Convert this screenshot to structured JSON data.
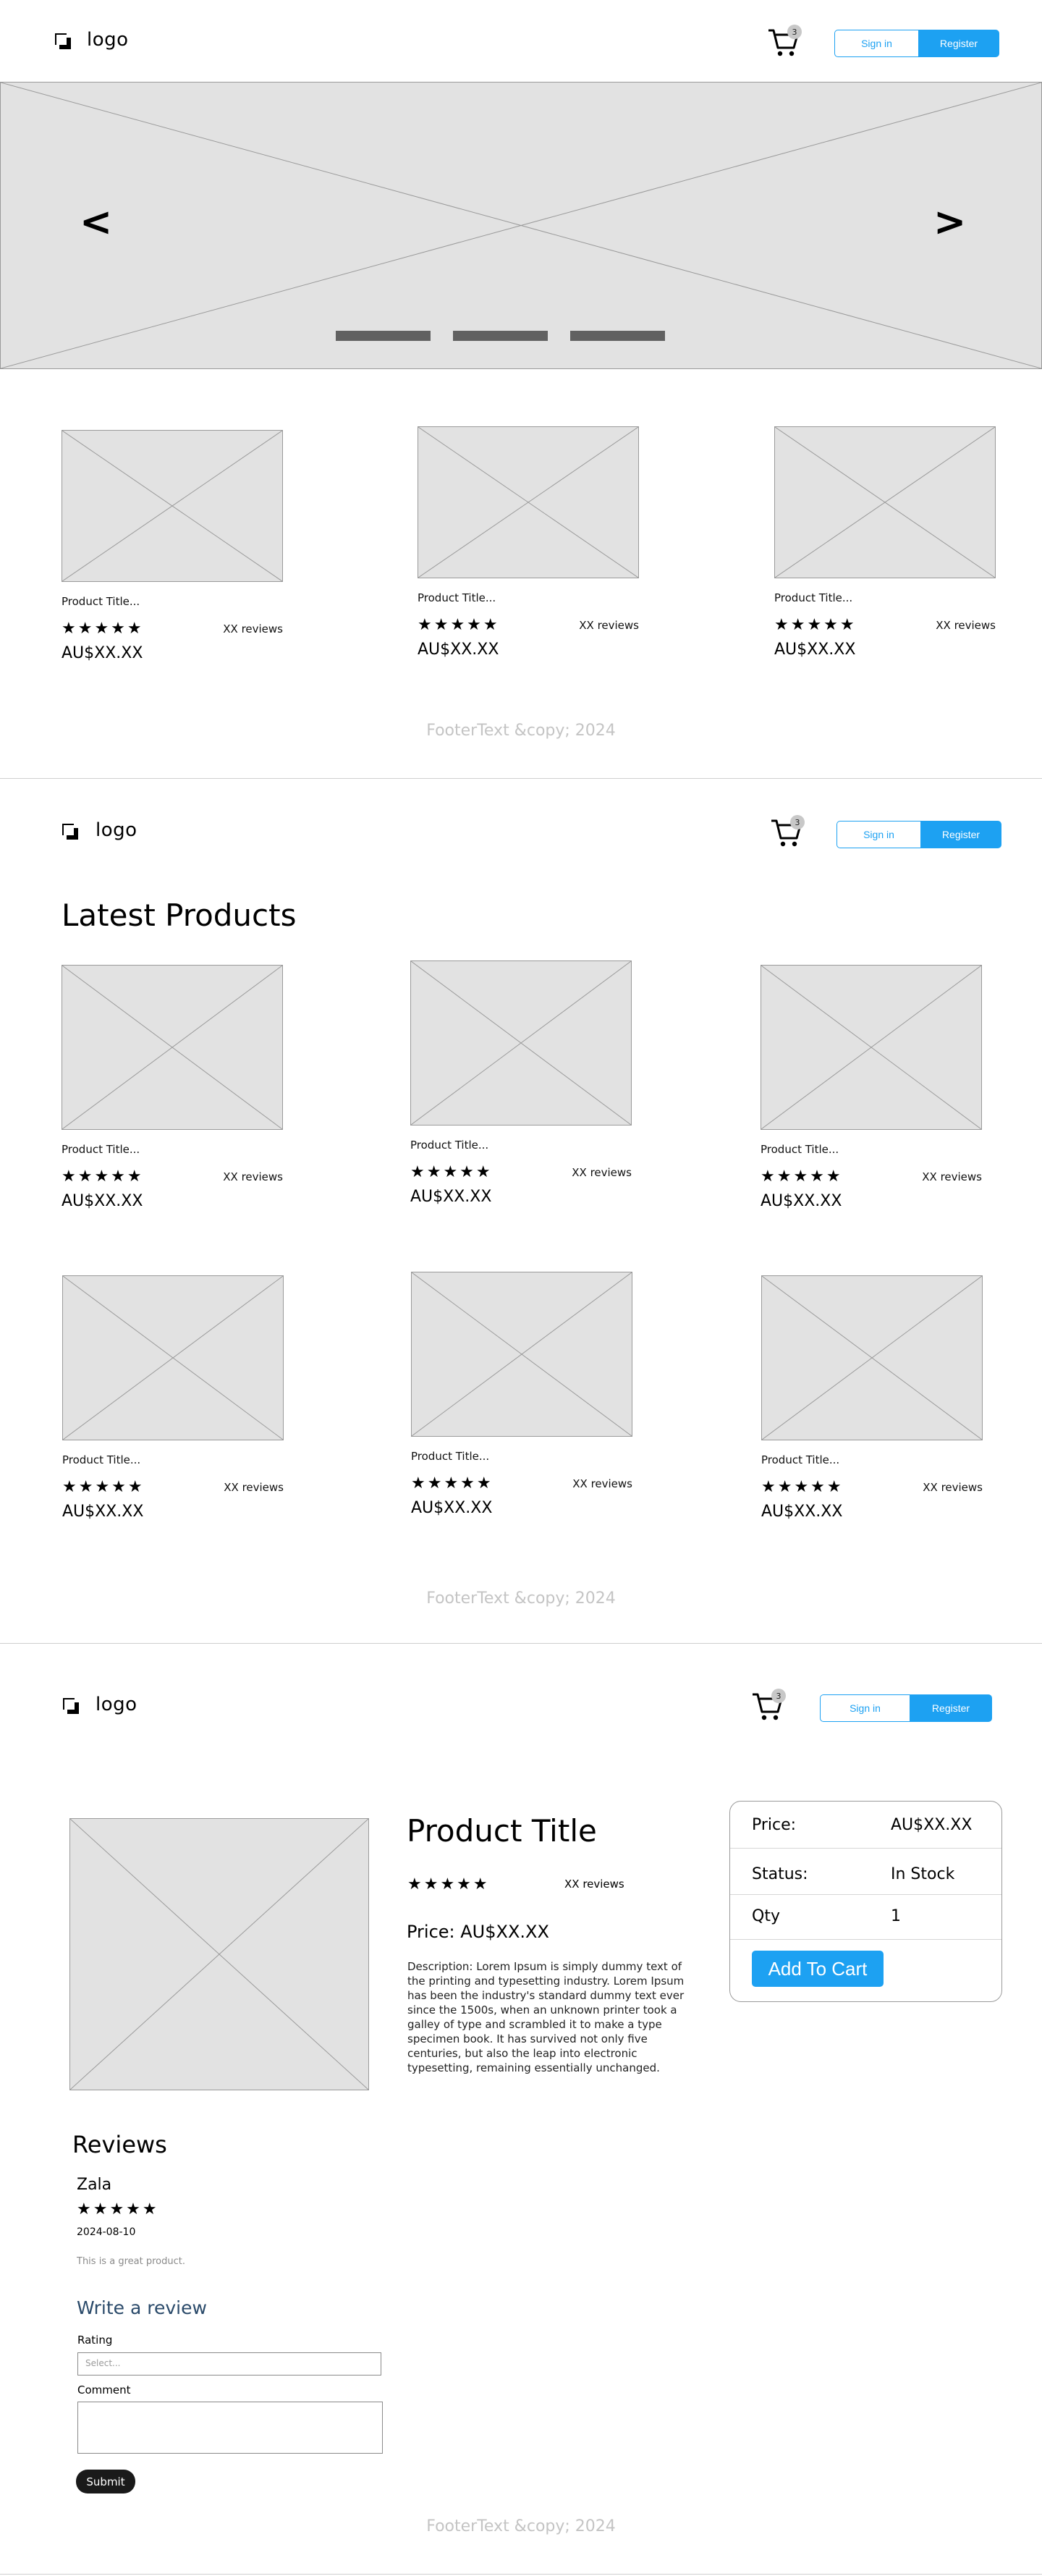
{
  "header": {
    "logo": "logo",
    "cart_count": "3",
    "signin": "Sign in",
    "register": "Register"
  },
  "hero": {
    "prev": "<",
    "next": ">"
  },
  "card": {
    "title": "Product Title...",
    "reviews": "XX reviews",
    "price": "AU$XX.XX",
    "stars": "★★★★★",
    "rating": 5
  },
  "footer": "FooterText &copy; 2024",
  "latest": {
    "heading": "Latest Products"
  },
  "detail": {
    "title": "Product Title",
    "stars": "★★★★★",
    "reviews": "XX reviews",
    "price": "Price: AU$XX.XX",
    "description": "Description:   Lorem Ipsum is simply dummy text of the printing and typesetting industry. Lorem Ipsum has been the industry's standard dummy text ever since the 1500s, when an unknown printer took a galley of type and scrambled it to make a type specimen book. It has survived not only five centuries, but also the leap into electronic typesetting, remaining essentially unchanged.",
    "box": {
      "price_label": "Price:",
      "price_value": "AU$XX.XX",
      "status_label": "Status:",
      "status_value": "In Stock",
      "qty_label": "Qty",
      "qty_value": "1",
      "add_to_cart": "Add To Cart"
    }
  },
  "reviews": {
    "heading": "Reviews",
    "items": [
      {
        "name": "Zala",
        "stars": "★★★★★",
        "date": "2024-08-10",
        "comment": "This is a great product."
      }
    ],
    "write_heading": "Write a review",
    "rating_label": "Rating",
    "rating_placeholder": "Select...",
    "comment_label": "Comment",
    "submit": "Submit"
  },
  "colors": {
    "accent": "#1da1f2",
    "placeholder_fill": "#e2e2e2",
    "footer_text": "#c4c4c4"
  }
}
